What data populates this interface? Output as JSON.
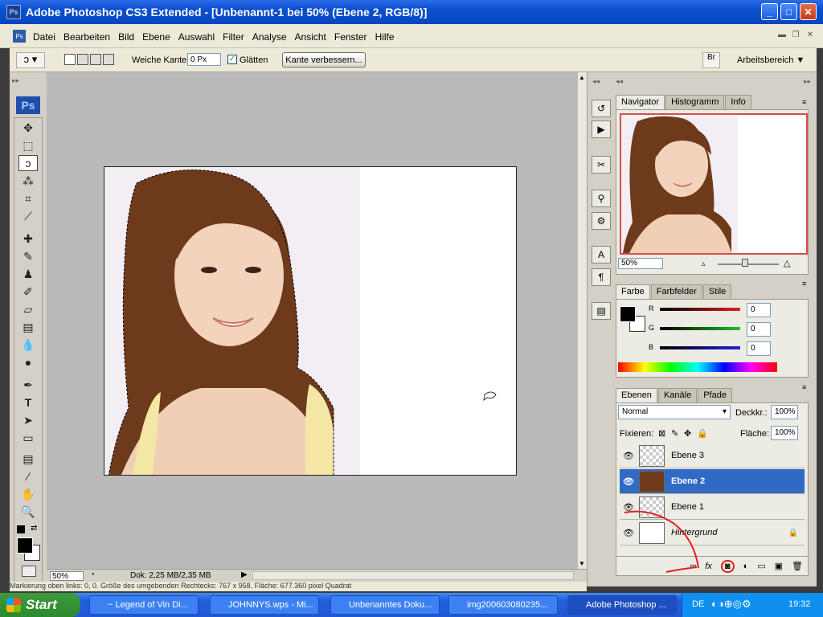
{
  "window": {
    "title": "Adobe Photoshop CS3 Extended - [Unbenannt-1 bei 50% (Ebene 2, RGB/8)]",
    "app_icon": "Ps"
  },
  "menu": [
    "Datei",
    "Bearbeiten",
    "Bild",
    "Ebene",
    "Auswahl",
    "Filter",
    "Analyse",
    "Ansicht",
    "Fenster",
    "Hilfe"
  ],
  "options": {
    "feather_label": "Weiche Kante:",
    "feather_value": "0 Px",
    "antialias_label": "Glätten",
    "refine_button": "Kante verbessern...",
    "workspace_label": "Arbeitsbereich"
  },
  "toolbox": {
    "logo": "Ps"
  },
  "status": {
    "zoom": "50%",
    "doc_info": "Dok: 2,25 MB/2,35 MB"
  },
  "hint": "Markierung oben links: 0, 0. Größe des umgebenden Rechtecks: 767 x 958. Fläche: 677.360 pixel Quadrat",
  "navigator": {
    "tabs": [
      "Navigator",
      "Histogramm",
      "Info"
    ],
    "zoom": "50%"
  },
  "color": {
    "tabs": [
      "Farbe",
      "Farbfelder",
      "Stile"
    ],
    "channels": [
      {
        "label": "R",
        "value": "0"
      },
      {
        "label": "G",
        "value": "0"
      },
      {
        "label": "B",
        "value": "0"
      }
    ]
  },
  "layers": {
    "tabs": [
      "Ebenen",
      "Kanäle",
      "Pfade"
    ],
    "blend_mode": "Normal",
    "opacity_label": "Deckkr.:",
    "opacity": "100%",
    "lock_label": "Fixieren:",
    "fill_label": "Fläche:",
    "fill": "100%",
    "items": [
      {
        "name": "Ebene 3",
        "selected": false
      },
      {
        "name": "Ebene 2",
        "selected": true
      },
      {
        "name": "Ebene 1",
        "selected": false
      },
      {
        "name": "Hintergrund",
        "selected": false
      }
    ]
  },
  "taskbar": {
    "start": "Start",
    "tasks": [
      "~ Legend of Vin Di...",
      "JOHNNYS.wps - Mi...",
      "Unbenanntes Doku...",
      "img200603080235...",
      "Adobe Photoshop ..."
    ],
    "lang": "DE",
    "clock": "19:32"
  },
  "colors": {
    "title_blue": "#0a4fd0",
    "selection_blue": "#316ac5",
    "annotation_red": "#e02020"
  }
}
